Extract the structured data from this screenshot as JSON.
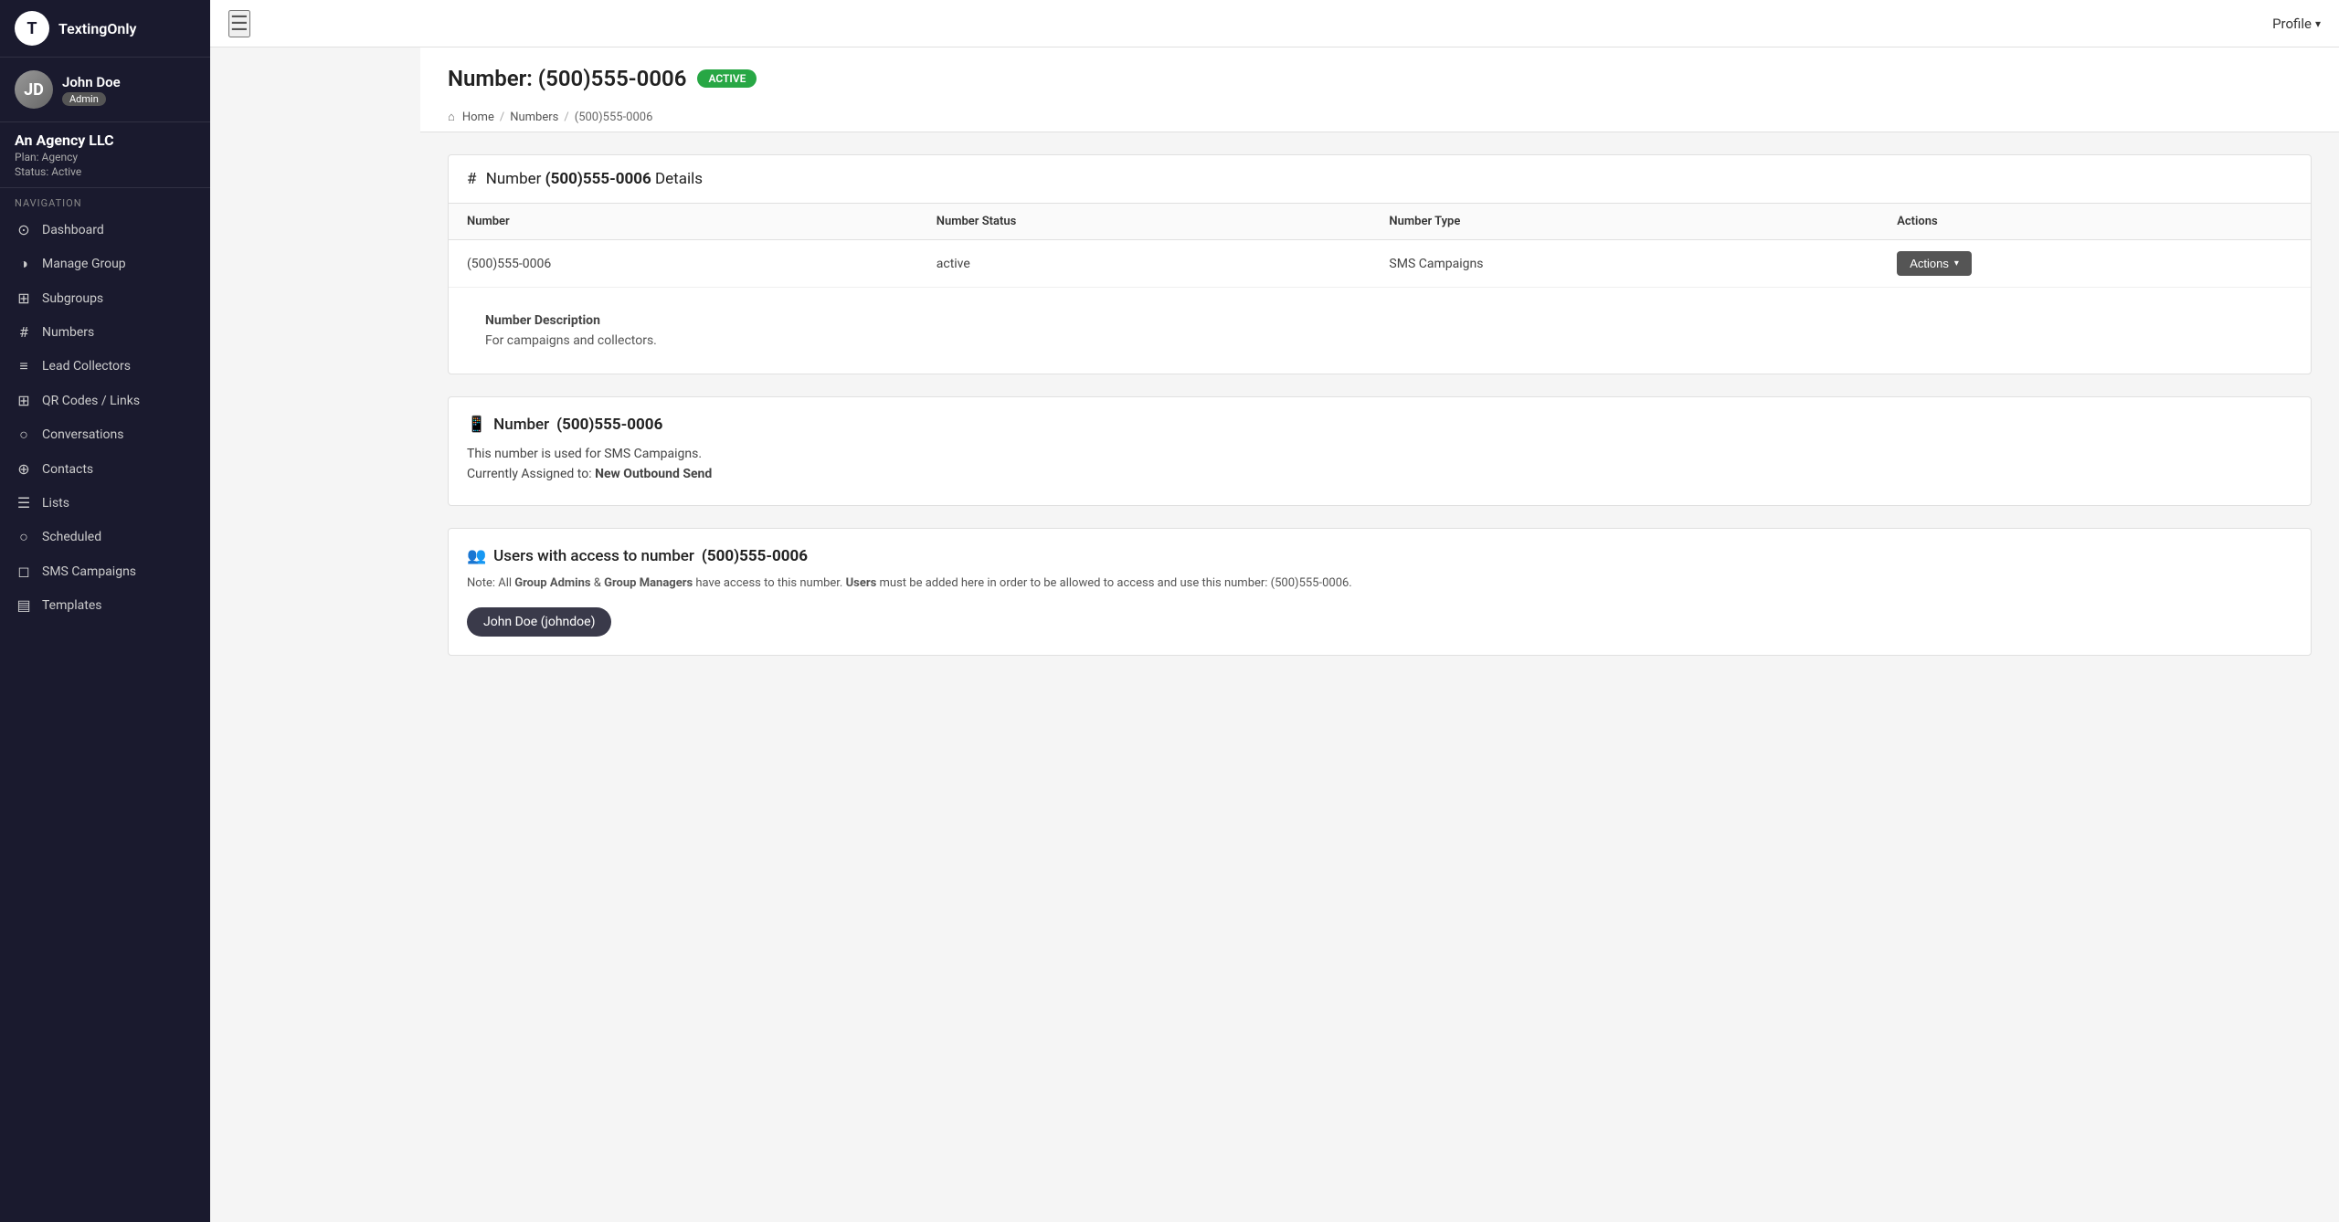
{
  "app": {
    "logo_letter": "T",
    "logo_name": "TextingOnly"
  },
  "user": {
    "name": "John Doe",
    "role": "Admin",
    "avatar_initials": "JD"
  },
  "agency": {
    "name": "An Agency LLC",
    "plan_label": "Plan:",
    "plan_value": "Agency",
    "status_label": "Status:",
    "status_value": "Active"
  },
  "nav": {
    "section_label": "NAVIGATION",
    "items": [
      {
        "id": "dashboard",
        "label": "Dashboard",
        "icon": "⊙"
      },
      {
        "id": "manage-group",
        "label": "Manage Group",
        "icon": "◑"
      },
      {
        "id": "subgroups",
        "label": "Subgroups",
        "icon": "⊞"
      },
      {
        "id": "numbers",
        "label": "Numbers",
        "icon": "#"
      },
      {
        "id": "lead-collectors",
        "label": "Lead Collectors",
        "icon": "≡"
      },
      {
        "id": "qr-codes",
        "label": "QR Codes / Links",
        "icon": "⊞"
      },
      {
        "id": "conversations",
        "label": "Conversations",
        "icon": "○"
      },
      {
        "id": "contacts",
        "label": "Contacts",
        "icon": "⊕"
      },
      {
        "id": "lists",
        "label": "Lists",
        "icon": "☰"
      },
      {
        "id": "scheduled",
        "label": "Scheduled",
        "icon": "○"
      },
      {
        "id": "sms-campaigns",
        "label": "SMS Campaigns",
        "icon": "◻"
      },
      {
        "id": "templates",
        "label": "Templates",
        "icon": "▤"
      }
    ]
  },
  "topbar": {
    "profile_label": "Profile",
    "hamburger_label": "☰"
  },
  "page": {
    "title_prefix": "Number: ",
    "title_number": "(500)555-0006",
    "status_badge": "ACTIVE",
    "breadcrumbs": [
      "Home",
      "Numbers",
      "(500)555-0006"
    ]
  },
  "details_section": {
    "title_prefix": "Number ",
    "title_number": "(500)555-0006",
    "title_suffix": " Details",
    "table": {
      "headers": [
        "Number",
        "Number Status",
        "Number Type",
        "Actions"
      ],
      "row": {
        "number": "(500)555-0006",
        "status": "active",
        "type": "SMS Campaigns",
        "actions_label": "Actions",
        "actions_caret": "▾"
      }
    },
    "description_label": "Number Description",
    "description_text": "For campaigns and collectors."
  },
  "phone_section": {
    "title_prefix": "Number ",
    "title_number": "(500)555-0006",
    "info_line1": "This number is used for SMS Campaigns.",
    "assigned_prefix": "Currently Assigned to: ",
    "assigned_value": "New Outbound Send"
  },
  "users_section": {
    "title_prefix": "Users with access to number ",
    "title_number": "(500)555-0006",
    "note": "Note: All Group Admins & Group Managers have access to this number. Users must be added here in order to be allowed to access and use this number: (500)555-0006.",
    "users": [
      {
        "label": "John Doe (johndoe)"
      }
    ]
  }
}
